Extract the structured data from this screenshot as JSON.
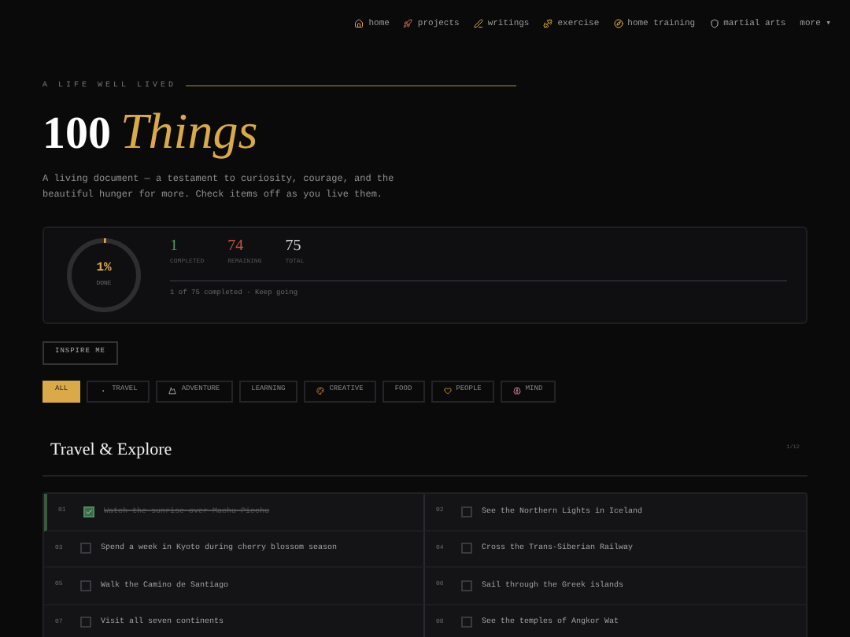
{
  "nav": {
    "items": [
      "home",
      "projects",
      "writings",
      "exercise",
      "home training",
      "martial arts"
    ],
    "more": "more ▾"
  },
  "hero": {
    "eyebrow": "A LIFE WELL LIVED",
    "title_number": "100",
    "title_word": "Things",
    "intro": "A living document — a testament to curiosity, courage, and the beautiful hunger for more. Check items off as you live them."
  },
  "progress": {
    "level": 0.01,
    "percent": "1%",
    "percent_label": "DONE",
    "stats": [
      {
        "value": "1",
        "label": "COMPLETED",
        "color": "#4f9a6a"
      },
      {
        "value": "74",
        "label": "REMAINING",
        "color": "#c2573c"
      },
      {
        "value": "75",
        "label": "TOTAL",
        "color": "#d6d6d6"
      }
    ],
    "note": "1 of 75 completed · Keep going"
  },
  "inspire_button": "INSPIRE ME",
  "filters": [
    {
      "label": "ALL",
      "selected": true
    },
    {
      "label": "TRAVEL",
      "selected": false
    },
    {
      "label": "ADVENTURE",
      "selected": false
    },
    {
      "label": "LEARNING",
      "selected": false
    },
    {
      "label": "CREATIVE",
      "selected": false
    },
    {
      "label": "FOOD",
      "selected": false
    },
    {
      "label": "PEOPLE",
      "selected": false
    },
    {
      "label": "MIND",
      "selected": false
    }
  ],
  "section": {
    "title": "Travel & Explore",
    "count": "1/12",
    "items": [
      {
        "number": "01",
        "text": "Watch the sunrise over Machu Picchu",
        "checked": true
      },
      {
        "number": "02",
        "text": "See the Northern Lights in Iceland",
        "checked": false
      },
      {
        "number": "03",
        "text": "Spend a week in Kyoto during cherry blossom season",
        "checked": false
      },
      {
        "number": "04",
        "text": "Cross the Trans-Siberian Railway",
        "checked": false
      },
      {
        "number": "05",
        "text": "Walk the Camino de Santiago",
        "checked": false
      },
      {
        "number": "06",
        "text": "Sail through the Greek islands",
        "checked": false
      },
      {
        "number": "07",
        "text": "Visit all seven continents",
        "checked": false
      },
      {
        "number": "08",
        "text": "See the temples of Angkor Wat",
        "checked": false
      }
    ]
  }
}
